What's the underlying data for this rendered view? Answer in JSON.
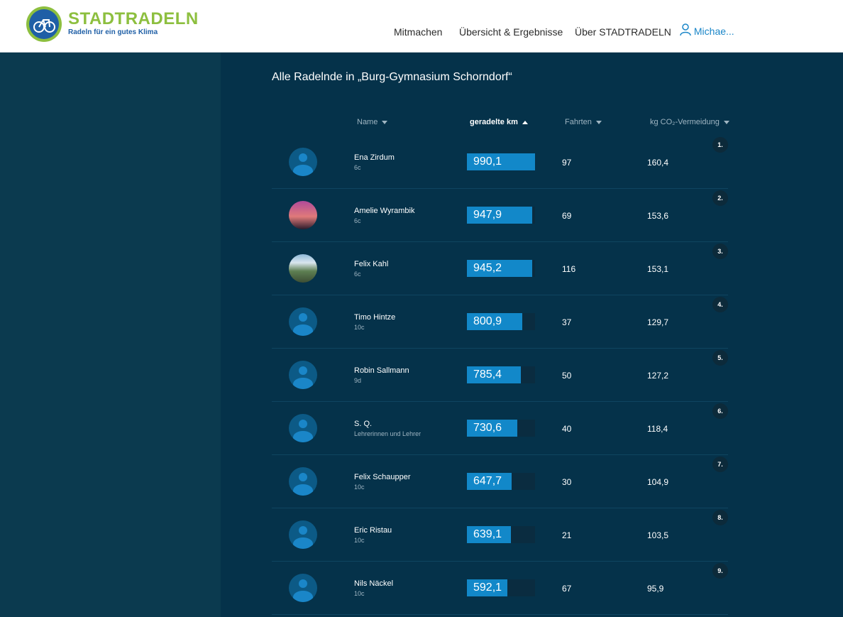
{
  "header": {
    "logo_title": "STADTRADELN",
    "logo_subtitle": "Radeln für ein gutes Klima",
    "nav": [
      "Mitmachen",
      "Übersicht & Ergebnisse",
      "Über STADTRADELN"
    ],
    "user_label": "Michae..."
  },
  "main": {
    "title": "Alle Radelnde in „Burg-Gymnasium Schorndorf“",
    "columns": {
      "name": "Name",
      "km": "geradelte km",
      "trips": "Fahrten",
      "co2": "kg CO₂-Vermeidung"
    },
    "rows": [
      {
        "rank": "1.",
        "name": "Ena Zirdum",
        "class": "6c",
        "km": "990,1",
        "km_value": 990.1,
        "trips": "97",
        "co2": "160,4",
        "avatar": "default"
      },
      {
        "rank": "2.",
        "name": "Amelie Wyrambik",
        "class": "6c",
        "km": "947,9",
        "km_value": 947.9,
        "trips": "69",
        "co2": "153,6",
        "avatar": "photo-1"
      },
      {
        "rank": "3.",
        "name": "Felix Kahl",
        "class": "6c",
        "km": "945,2",
        "km_value": 945.2,
        "trips": "116",
        "co2": "153,1",
        "avatar": "photo-2"
      },
      {
        "rank": "4.",
        "name": "Timo Hintze",
        "class": "10c",
        "km": "800,9",
        "km_value": 800.9,
        "trips": "37",
        "co2": "129,7",
        "avatar": "default"
      },
      {
        "rank": "5.",
        "name": "Robin Sallmann",
        "class": "9d",
        "km": "785,4",
        "km_value": 785.4,
        "trips": "50",
        "co2": "127,2",
        "avatar": "default"
      },
      {
        "rank": "6.",
        "name": "S. Q.",
        "class": "Lehrerinnen und Lehrer",
        "km": "730,6",
        "km_value": 730.6,
        "trips": "40",
        "co2": "118,4",
        "avatar": "default"
      },
      {
        "rank": "7.",
        "name": "Felix Schaupper",
        "class": "10c",
        "km": "647,7",
        "km_value": 647.7,
        "trips": "30",
        "co2": "104,9",
        "avatar": "default"
      },
      {
        "rank": "8.",
        "name": "Eric Ristau",
        "class": "10c",
        "km": "639,1",
        "km_value": 639.1,
        "trips": "21",
        "co2": "103,5",
        "avatar": "default"
      },
      {
        "rank": "9.",
        "name": "Nils Näckel",
        "class": "10c",
        "km": "592,1",
        "km_value": 592.1,
        "trips": "67",
        "co2": "95,9",
        "avatar": "default"
      }
    ]
  }
}
